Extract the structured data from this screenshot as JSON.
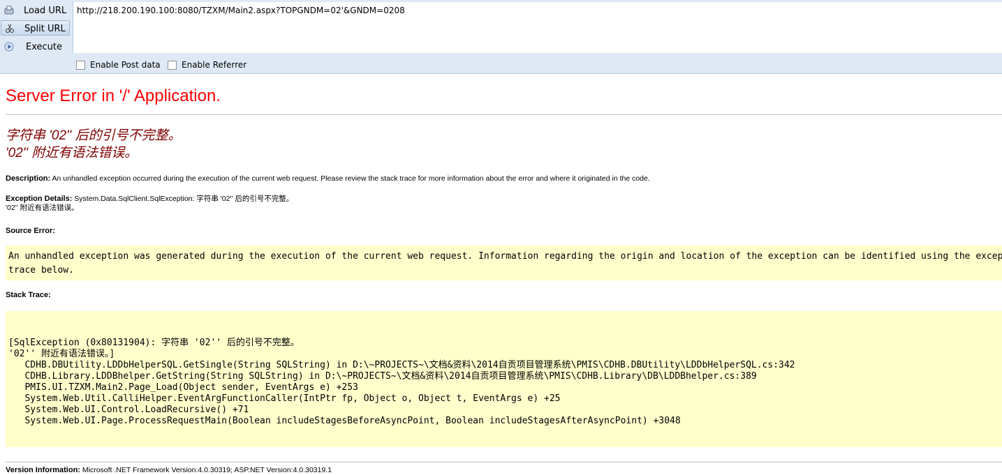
{
  "toolbar": {
    "load_url": "Load URL",
    "split_url": "Split URL",
    "execute": "Execute",
    "url_value": "http://218.200.190.100:8080/TZXM/Main2.aspx?TOPGNDM=02'&GNDM=0208",
    "enable_post": "Enable Post data",
    "enable_referrer": "Enable Referrer"
  },
  "page": {
    "title": "Server Error in '/' Application.",
    "error_line1": "字符串 '02'' 后的引号不完整。",
    "error_line2": "'02'' 附近有语法错误。",
    "description_label": "Description:",
    "description_text": " An unhandled exception occurred during the execution of the current web request. Please review the stack trace for more information about the error and where it originated in the code.",
    "exception_label": "Exception Details:",
    "exception_text": " System.Data.SqlClient.SqlException: 字符串 '02'' 后的引号不完整。",
    "exception_text2": "'02'' 附近有语法错误。",
    "source_error_label": "Source Error:",
    "source_error_text": "An unhandled exception was generated during the execution of the current web request. Information regarding the origin and location of the exception can be identified using the exception stack\ntrace below.",
    "stack_trace_label": "Stack Trace:",
    "stack_trace_text": "[SqlException (0x80131904): 字符串 '02'' 后的引号不完整。\n'02'' 附近有语法错误。]\n   CDHB.DBUtility.LDDbHelperSQL.GetSingle(String SQLString) in D:\\~PROJECTS~\\文档&资料\\2014自贡项目管理系统\\PMIS\\CDHB.DBUtility\\LDDbHelperSQL.cs:342\n   CDHB.Library.LDDBhelper.GetString(String SQLString) in D:\\~PROJECTS~\\文档&资料\\2014自贡项目管理系统\\PMIS\\CDHB.Library\\DB\\LDDBhelper.cs:389\n   PMIS.UI.TZXM.Main2.Page_Load(Object sender, EventArgs e) +253\n   System.Web.Util.CalliHelper.EventArgFunctionCaller(IntPtr fp, Object o, Object t, EventArgs e) +25\n   System.Web.UI.Control.LoadRecursive() +71\n   System.Web.UI.Page.ProcessRequestMain(Boolean includeStagesBeforeAsyncPoint, Boolean includeStagesAfterAsyncPoint) +3048",
    "version_label": "Version Information:",
    "version_text": " Microsoft .NET Framework Version:4.0.30319; ASP.NET Version:4.0.30319.1"
  }
}
